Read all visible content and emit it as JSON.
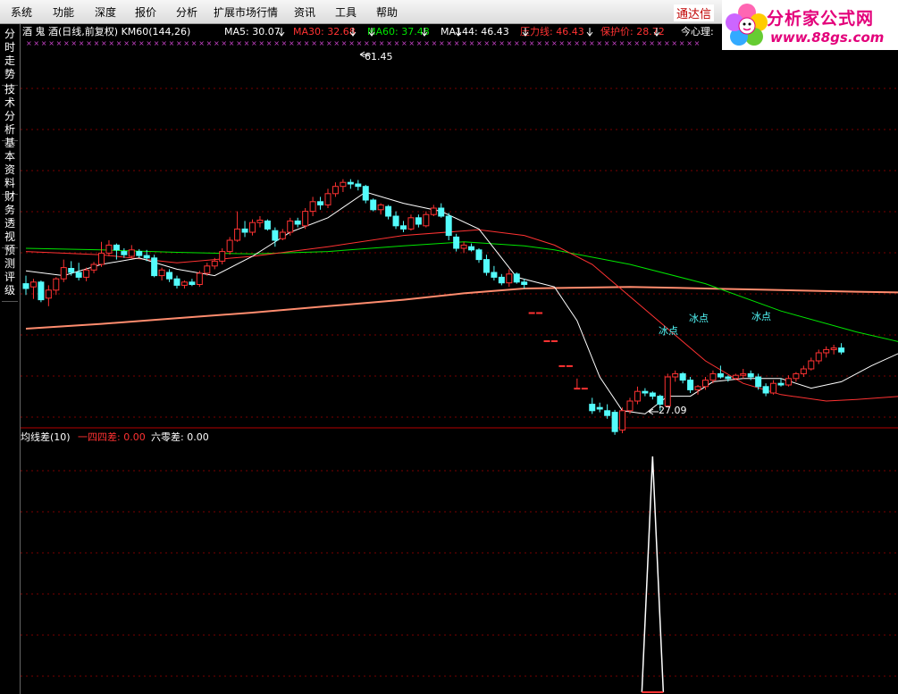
{
  "menu": [
    "系统",
    "功能",
    "深度",
    "报价",
    "分析",
    "扩展市场行情",
    "资讯",
    "工具",
    "帮助"
  ],
  "tongda_label": "通达信",
  "logo": {
    "brand": "分析家公式网",
    "url": "www.88gs.com"
  },
  "sidebar": [
    "分时走势",
    "技术分析",
    "基本资料",
    "财务透视",
    "预测评级"
  ],
  "header": {
    "title": "酒 鬼 酒(日线,前复权) KM60(144,26)",
    "ma5": "MA5: 30.07",
    "ma30": "MA30: 32.68",
    "ma60": "MA60: 37.48",
    "ma144": "MA144: 46.43",
    "pressure": "压力线: 46.43",
    "protect": "保护价: 28.72",
    "mind": "今心理:"
  },
  "annotations": {
    "high": "61.45",
    "low": "27.09",
    "ice1": "冰点",
    "ice2": "冰点",
    "ice3": "冰点"
  },
  "sub_header": {
    "title": "均线差(10)",
    "s1": "一四四差: 0.00",
    "s2": "六零差: 0.00"
  },
  "colors": {
    "up": "#ff3232",
    "down": "#54fcfc",
    "ma5": "#ffffff",
    "ma30": "#ff3232",
    "ma60": "#00e600",
    "ma144": "#ff8c6e",
    "grid": "#7a0000"
  },
  "chart_data": {
    "type": "candlestick",
    "ylim": [
      22,
      68
    ],
    "candles": [
      {
        "o": 38.6,
        "h": 39.6,
        "l": 37.2,
        "c": 38.0
      },
      {
        "o": 38.2,
        "h": 39.2,
        "l": 36.7,
        "c": 38.8
      },
      {
        "o": 38.8,
        "h": 39.0,
        "l": 36.3,
        "c": 36.6
      },
      {
        "o": 36.8,
        "h": 38.4,
        "l": 35.8,
        "c": 37.8
      },
      {
        "o": 37.8,
        "h": 39.4,
        "l": 37.2,
        "c": 39.2
      },
      {
        "o": 39.2,
        "h": 41.6,
        "l": 38.8,
        "c": 40.6
      },
      {
        "o": 40.5,
        "h": 41.4,
        "l": 39.6,
        "c": 40.0
      },
      {
        "o": 40.0,
        "h": 41.2,
        "l": 39.0,
        "c": 39.4
      },
      {
        "o": 39.4,
        "h": 40.6,
        "l": 38.9,
        "c": 40.3
      },
      {
        "o": 40.3,
        "h": 41.3,
        "l": 39.9,
        "c": 41.0
      },
      {
        "o": 41.0,
        "h": 43.8,
        "l": 40.7,
        "c": 42.4
      },
      {
        "o": 42.4,
        "h": 44.0,
        "l": 42.0,
        "c": 43.4
      },
      {
        "o": 43.4,
        "h": 43.6,
        "l": 41.6,
        "c": 42.8
      },
      {
        "o": 42.6,
        "h": 43.0,
        "l": 41.8,
        "c": 42.2
      },
      {
        "o": 42.0,
        "h": 43.4,
        "l": 41.8,
        "c": 42.8
      },
      {
        "o": 42.6,
        "h": 42.9,
        "l": 41.8,
        "c": 42.1
      },
      {
        "o": 42.1,
        "h": 42.8,
        "l": 41.4,
        "c": 41.8
      },
      {
        "o": 41.8,
        "h": 42.2,
        "l": 39.4,
        "c": 39.6
      },
      {
        "o": 39.6,
        "h": 40.6,
        "l": 39.0,
        "c": 40.3
      },
      {
        "o": 40.0,
        "h": 40.4,
        "l": 38.8,
        "c": 39.2
      },
      {
        "o": 39.2,
        "h": 39.6,
        "l": 38.0,
        "c": 38.4
      },
      {
        "o": 38.4,
        "h": 39.0,
        "l": 38.0,
        "c": 38.8
      },
      {
        "o": 38.8,
        "h": 39.2,
        "l": 38.3,
        "c": 38.5
      },
      {
        "o": 38.5,
        "h": 40.2,
        "l": 38.2,
        "c": 39.9
      },
      {
        "o": 39.9,
        "h": 41.2,
        "l": 39.6,
        "c": 40.8
      },
      {
        "o": 40.8,
        "h": 41.8,
        "l": 40.4,
        "c": 41.4
      },
      {
        "o": 41.4,
        "h": 43.0,
        "l": 41.0,
        "c": 42.6
      },
      {
        "o": 42.6,
        "h": 44.4,
        "l": 42.2,
        "c": 44.0
      },
      {
        "o": 44.0,
        "h": 47.6,
        "l": 43.8,
        "c": 45.4
      },
      {
        "o": 45.4,
        "h": 46.4,
        "l": 44.4,
        "c": 45.0
      },
      {
        "o": 45.0,
        "h": 46.6,
        "l": 44.6,
        "c": 46.2
      },
      {
        "o": 46.2,
        "h": 47.0,
        "l": 45.6,
        "c": 46.5
      },
      {
        "o": 46.4,
        "h": 46.6,
        "l": 45.2,
        "c": 45.4
      },
      {
        "o": 45.2,
        "h": 45.6,
        "l": 43.2,
        "c": 44.0
      },
      {
        "o": 44.2,
        "h": 45.4,
        "l": 44.0,
        "c": 45.0
      },
      {
        "o": 45.0,
        "h": 46.8,
        "l": 44.6,
        "c": 46.4
      },
      {
        "o": 46.4,
        "h": 46.8,
        "l": 45.6,
        "c": 46.0
      },
      {
        "o": 45.8,
        "h": 48.0,
        "l": 45.4,
        "c": 47.6
      },
      {
        "o": 47.6,
        "h": 49.4,
        "l": 47.0,
        "c": 48.8
      },
      {
        "o": 48.8,
        "h": 49.4,
        "l": 47.8,
        "c": 48.4
      },
      {
        "o": 48.4,
        "h": 50.4,
        "l": 48.0,
        "c": 49.8
      },
      {
        "o": 49.8,
        "h": 51.2,
        "l": 49.4,
        "c": 50.7
      },
      {
        "o": 50.7,
        "h": 51.6,
        "l": 50.0,
        "c": 51.2
      },
      {
        "o": 51.2,
        "h": 51.6,
        "l": 50.4,
        "c": 51.0
      },
      {
        "o": 51.0,
        "h": 51.5,
        "l": 50.2,
        "c": 50.7
      },
      {
        "o": 50.7,
        "h": 50.9,
        "l": 48.6,
        "c": 49.0
      },
      {
        "o": 49.0,
        "h": 49.2,
        "l": 47.6,
        "c": 47.8
      },
      {
        "o": 47.8,
        "h": 48.6,
        "l": 47.2,
        "c": 48.4
      },
      {
        "o": 48.2,
        "h": 48.4,
        "l": 46.6,
        "c": 47.0
      },
      {
        "o": 47.0,
        "h": 47.6,
        "l": 45.4,
        "c": 45.8
      },
      {
        "o": 45.8,
        "h": 46.4,
        "l": 45.0,
        "c": 45.4
      },
      {
        "o": 45.4,
        "h": 47.2,
        "l": 45.2,
        "c": 46.8
      },
      {
        "o": 46.8,
        "h": 47.2,
        "l": 45.6,
        "c": 46.0
      },
      {
        "o": 45.8,
        "h": 47.6,
        "l": 45.6,
        "c": 47.2
      },
      {
        "o": 47.2,
        "h": 48.4,
        "l": 47.0,
        "c": 48.0
      },
      {
        "o": 48.0,
        "h": 48.6,
        "l": 46.8,
        "c": 47.0
      },
      {
        "o": 47.0,
        "h": 47.4,
        "l": 44.0,
        "c": 44.6
      },
      {
        "o": 44.4,
        "h": 44.8,
        "l": 42.6,
        "c": 43.0
      },
      {
        "o": 43.0,
        "h": 43.8,
        "l": 42.4,
        "c": 43.4
      },
      {
        "o": 43.2,
        "h": 43.6,
        "l": 42.6,
        "c": 42.8
      },
      {
        "o": 42.8,
        "h": 43.0,
        "l": 41.2,
        "c": 41.6
      },
      {
        "o": 41.6,
        "h": 42.2,
        "l": 39.6,
        "c": 40.0
      },
      {
        "o": 40.0,
        "h": 40.8,
        "l": 39.0,
        "c": 39.4
      },
      {
        "o": 39.4,
        "h": 39.8,
        "l": 38.4,
        "c": 38.7
      },
      {
        "o": 38.7,
        "h": 40.4,
        "l": 38.2,
        "c": 39.8
      },
      {
        "o": 39.8,
        "h": 40.0,
        "l": 38.6,
        "c": 38.8
      },
      {
        "o": 38.8,
        "h": 39.2,
        "l": 38.0,
        "c": 38.5
      },
      {
        "o": 35.0,
        "h": 35.0,
        "l": 35.0,
        "c": 35.0
      },
      {
        "o": 35.0,
        "h": 35.0,
        "l": 35.0,
        "c": 35.0
      },
      {
        "o": 31.5,
        "h": 31.5,
        "l": 31.5,
        "c": 31.5
      },
      {
        "o": 31.5,
        "h": 31.5,
        "l": 31.5,
        "c": 31.5
      },
      {
        "o": 28.4,
        "h": 28.4,
        "l": 28.4,
        "c": 28.4
      },
      {
        "o": 28.4,
        "h": 28.4,
        "l": 28.4,
        "c": 28.4
      },
      {
        "o": 25.6,
        "h": 26.8,
        "l": 25.6,
        "c": 25.6
      },
      {
        "o": 25.6,
        "h": 25.6,
        "l": 25.6,
        "c": 25.6
      },
      {
        "o": 23.6,
        "h": 24.4,
        "l": 22.4,
        "c": 22.8
      },
      {
        "o": 23.2,
        "h": 23.8,
        "l": 22.6,
        "c": 23.0
      },
      {
        "o": 22.8,
        "h": 23.6,
        "l": 21.8,
        "c": 22.2
      },
      {
        "o": 22.6,
        "h": 22.9,
        "l": 19.8,
        "c": 20.2
      },
      {
        "o": 20.4,
        "h": 23.2,
        "l": 20.0,
        "c": 22.8
      },
      {
        "o": 22.8,
        "h": 24.4,
        "l": 22.4,
        "c": 24.0
      },
      {
        "o": 24.0,
        "h": 25.8,
        "l": 23.6,
        "c": 25.2
      },
      {
        "o": 25.2,
        "h": 25.6,
        "l": 24.6,
        "c": 25.0
      },
      {
        "o": 25.0,
        "h": 25.2,
        "l": 24.2,
        "c": 24.6
      },
      {
        "o": 24.6,
        "h": 24.8,
        "l": 22.8,
        "c": 23.6
      },
      {
        "o": 23.4,
        "h": 27.4,
        "l": 23.2,
        "c": 27.0
      },
      {
        "o": 27.0,
        "h": 27.8,
        "l": 26.4,
        "c": 27.4
      },
      {
        "o": 27.4,
        "h": 27.6,
        "l": 26.2,
        "c": 26.6
      },
      {
        "o": 26.6,
        "h": 27.0,
        "l": 25.0,
        "c": 25.4
      },
      {
        "o": 25.4,
        "h": 26.0,
        "l": 24.8,
        "c": 25.8
      },
      {
        "o": 25.8,
        "h": 27.0,
        "l": 25.4,
        "c": 26.6
      },
      {
        "o": 26.6,
        "h": 27.8,
        "l": 26.2,
        "c": 27.4
      },
      {
        "o": 27.4,
        "h": 28.4,
        "l": 26.8,
        "c": 27.0
      },
      {
        "o": 27.0,
        "h": 27.2,
        "l": 26.4,
        "c": 26.8
      },
      {
        "o": 26.8,
        "h": 27.4,
        "l": 26.6,
        "c": 27.2
      },
      {
        "o": 27.2,
        "h": 28.0,
        "l": 26.8,
        "c": 27.4
      },
      {
        "o": 27.4,
        "h": 27.8,
        "l": 26.6,
        "c": 27.0
      },
      {
        "o": 27.0,
        "h": 27.4,
        "l": 25.4,
        "c": 25.8
      },
      {
        "o": 25.8,
        "h": 26.2,
        "l": 24.6,
        "c": 25.0
      },
      {
        "o": 25.0,
        "h": 26.6,
        "l": 24.8,
        "c": 26.2
      },
      {
        "o": 26.2,
        "h": 26.8,
        "l": 25.8,
        "c": 26.0
      },
      {
        "o": 26.0,
        "h": 27.2,
        "l": 25.8,
        "c": 26.8
      },
      {
        "o": 26.8,
        "h": 27.6,
        "l": 26.4,
        "c": 27.4
      },
      {
        "o": 27.4,
        "h": 28.4,
        "l": 27.0,
        "c": 28.0
      },
      {
        "o": 28.0,
        "h": 29.4,
        "l": 27.8,
        "c": 29.0
      },
      {
        "o": 29.0,
        "h": 30.4,
        "l": 28.6,
        "c": 30.0
      },
      {
        "o": 30.0,
        "h": 30.8,
        "l": 29.4,
        "c": 30.4
      },
      {
        "o": 30.4,
        "h": 31.0,
        "l": 29.8,
        "c": 30.6
      },
      {
        "o": 30.6,
        "h": 31.2,
        "l": 29.8,
        "c": 30.1
      }
    ],
    "ma144": [
      [
        0,
        33.0
      ],
      [
        10,
        33.6
      ],
      [
        20,
        34.3
      ],
      [
        30,
        35.0
      ],
      [
        40,
        35.8
      ],
      [
        50,
        36.6
      ],
      [
        58,
        37.4
      ],
      [
        66,
        38.0
      ],
      [
        80,
        38.2
      ],
      [
        90,
        38.0
      ],
      [
        100,
        37.8
      ],
      [
        110,
        37.6
      ],
      [
        116,
        37.5
      ]
    ],
    "ma60": [
      [
        0,
        43.0
      ],
      [
        10,
        42.8
      ],
      [
        20,
        42.5
      ],
      [
        30,
        42.3
      ],
      [
        40,
        42.6
      ],
      [
        50,
        43.3
      ],
      [
        58,
        43.8
      ],
      [
        66,
        43.3
      ],
      [
        70,
        42.8
      ],
      [
        80,
        41.0
      ],
      [
        90,
        38.6
      ],
      [
        100,
        35.2
      ],
      [
        110,
        32.6
      ],
      [
        116,
        31.3
      ]
    ],
    "ma30": [
      [
        0,
        42.6
      ],
      [
        10,
        42.2
      ],
      [
        20,
        41.2
      ],
      [
        30,
        42.0
      ],
      [
        40,
        43.2
      ],
      [
        50,
        44.6
      ],
      [
        60,
        45.3
      ],
      [
        66,
        44.6
      ],
      [
        70,
        43.4
      ],
      [
        75,
        41.0
      ],
      [
        80,
        37.0
      ],
      [
        85,
        33.0
      ],
      [
        90,
        29.0
      ],
      [
        95,
        26.2
      ],
      [
        100,
        24.8
      ],
      [
        106,
        24.0
      ],
      [
        110,
        24.2
      ],
      [
        116,
        24.6
      ]
    ],
    "ma5": [
      [
        0,
        40.2
      ],
      [
        5,
        39.6
      ],
      [
        10,
        41.0
      ],
      [
        15,
        41.8
      ],
      [
        20,
        40.4
      ],
      [
        25,
        39.6
      ],
      [
        30,
        42.0
      ],
      [
        35,
        45.0
      ],
      [
        40,
        46.8
      ],
      [
        45,
        50.0
      ],
      [
        50,
        48.6
      ],
      [
        55,
        47.6
      ],
      [
        60,
        45.4
      ],
      [
        65,
        39.4
      ],
      [
        70,
        38.2
      ],
      [
        73,
        34.0
      ],
      [
        76,
        27.0
      ],
      [
        79,
        22.8
      ],
      [
        82,
        22.4
      ],
      [
        85,
        24.6
      ],
      [
        88,
        24.6
      ],
      [
        91,
        26.4
      ],
      [
        95,
        26.8
      ],
      [
        100,
        26.8
      ],
      [
        104,
        25.6
      ],
      [
        108,
        26.4
      ],
      [
        112,
        28.4
      ],
      [
        116,
        30.1
      ]
    ],
    "sub": {
      "spike_index": 83
    }
  }
}
